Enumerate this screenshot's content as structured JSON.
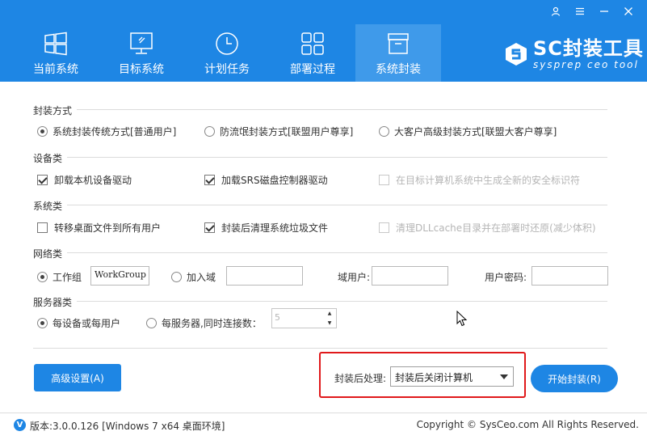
{
  "window": {
    "controls": [
      "user-icon",
      "menu-icon",
      "minimize-icon",
      "close-icon"
    ],
    "control_glyphs": [
      "♙",
      "≡",
      "—",
      "✕"
    ]
  },
  "nav": {
    "items": [
      {
        "label": "当前系统",
        "icon": "windows-icon",
        "active": false
      },
      {
        "label": "目标系统",
        "icon": "monitor-icon",
        "active": false
      },
      {
        "label": "计划任务",
        "icon": "clock-icon",
        "active": false
      },
      {
        "label": "部署过程",
        "icon": "grid-icon",
        "active": false
      },
      {
        "label": "系统封装",
        "icon": "box-icon",
        "active": true
      }
    ]
  },
  "brand": {
    "title": "SC封装工具",
    "subtitle": "sysprep ceo tool"
  },
  "sections": {
    "pack_mode": {
      "title": "封装方式",
      "options": [
        {
          "label": "系统封装传统方式[普通用户]",
          "selected": true
        },
        {
          "label": "防流氓封装方式[联盟用户尊享]",
          "selected": false
        },
        {
          "label": "大客户高级封装方式[联盟大客户尊享]",
          "selected": false
        }
      ]
    },
    "device": {
      "title": "设备类",
      "options": [
        {
          "label": "卸载本机设备驱动",
          "checked": true,
          "disabled": false
        },
        {
          "label": "加载SRS磁盘控制器驱动",
          "checked": true,
          "disabled": false
        },
        {
          "label": "在目标计算机系统中生成全新的安全标识符",
          "checked": false,
          "disabled": true
        }
      ]
    },
    "system": {
      "title": "系统类",
      "options": [
        {
          "label": "转移桌面文件到所有用户",
          "checked": false,
          "disabled": false
        },
        {
          "label": "封装后清理系统垃圾文件",
          "checked": true,
          "disabled": false
        },
        {
          "label": "清理DLLcache目录并在部署时还原(减少体积)",
          "checked": false,
          "disabled": true
        }
      ]
    },
    "network": {
      "title": "网络类",
      "workgroup_label": "工作组",
      "workgroup_value": "WorkGroup",
      "domain_label": "加入域",
      "domain_value": "",
      "domain_user_label": "域用户:",
      "domain_user_value": "",
      "password_label": "用户密码:",
      "password_value": ""
    },
    "server": {
      "title": "服务器类",
      "per_device_label": "每设备或每用户",
      "per_server_label": "每服务器,同时连接数：",
      "connections_value": "5"
    }
  },
  "buttons": {
    "advanced": "高级设置(A)",
    "start": "开始封装(R)"
  },
  "post_process": {
    "label": "封装后处理:",
    "selected": "封装后关闭计算机"
  },
  "footer": {
    "version_icon": "V",
    "version": "版本:3.0.0.126 [Windows 7 x64 桌面环境]",
    "copyright": "Copyright © SysCeo.com All Rights Reserved."
  },
  "colors": {
    "accent": "#1e86e4",
    "nav_active": "#3f9aea",
    "highlight_box": "#e0191b"
  }
}
